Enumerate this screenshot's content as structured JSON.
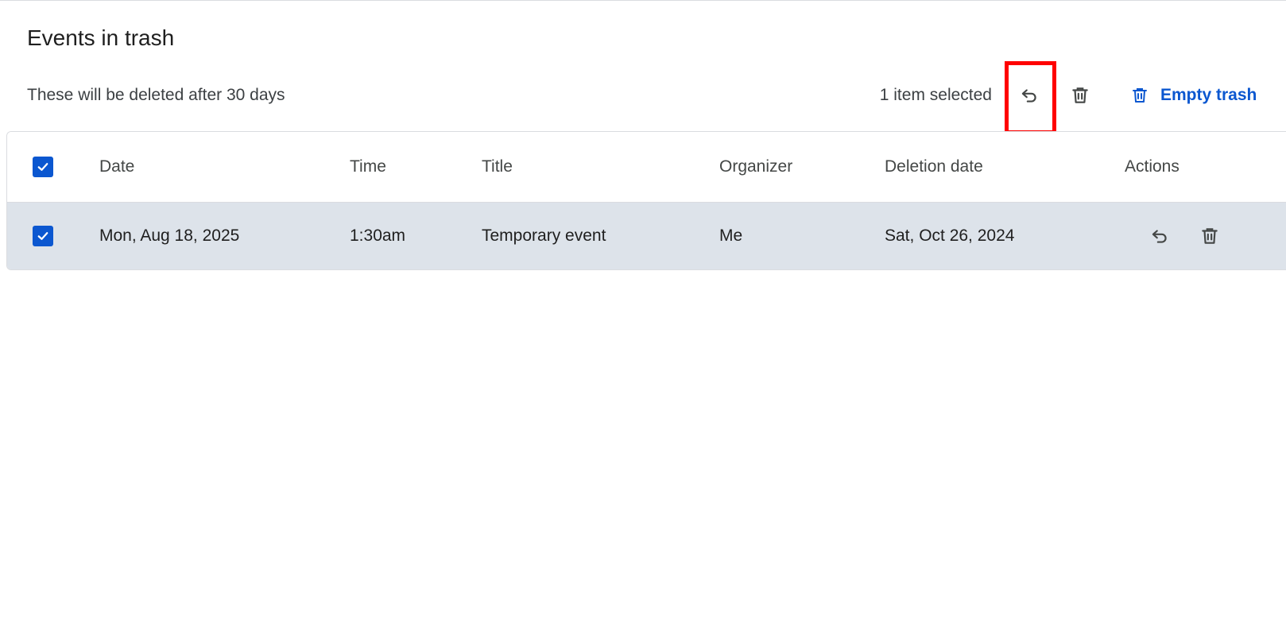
{
  "header": {
    "title": "Events in trash",
    "subtitle": "These will be deleted after 30 days"
  },
  "toolbar": {
    "selected_count": "1 item selected",
    "restore_icon": "restore-icon",
    "delete_icon": "delete-icon",
    "empty_trash_label": "Empty trash",
    "empty_trash_icon": "trash-icon"
  },
  "colors": {
    "accent": "#0b57d0",
    "selected_row": "#dde3ea",
    "highlight": "#ff0000"
  },
  "table": {
    "columns": [
      "Date",
      "Time",
      "Title",
      "Organizer",
      "Deletion date",
      "Actions"
    ],
    "rows": [
      {
        "selected": true,
        "date": "Mon, Aug 18, 2025",
        "time": "1:30am",
        "title": "Temporary event",
        "organizer": "Me",
        "deletion_date": "Sat, Oct 26, 2024"
      }
    ]
  }
}
